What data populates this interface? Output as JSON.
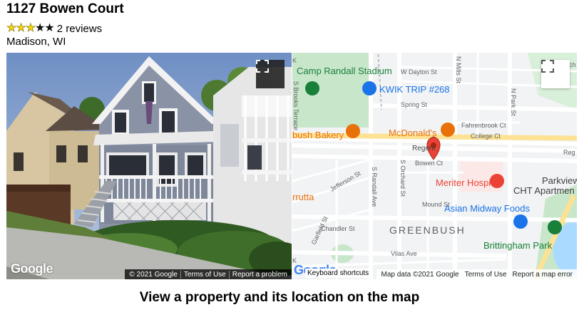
{
  "listing": {
    "title": "1127 Bowen Court",
    "rating": 3,
    "rating_max": 5,
    "reviews": "2 reviews",
    "city": "Madison, WI"
  },
  "street_view": {
    "logo": "Google",
    "attribution": [
      "© 2021 Google",
      "Terms of Use",
      "Report a problem"
    ],
    "fullscreen_icon": "fullscreen-icon"
  },
  "map": {
    "labels": {
      "camp_randall": "Camp Randall Stadium",
      "w_dayton": "W Dayton St",
      "kwik_trip": "KWIK TRIP #268",
      "spring": "Spring St",
      "bakery": "bush Bakery",
      "mcdonalds": "McDonald's",
      "fahrenbrook": "Fahrenbrook Ct",
      "college": "College Ct",
      "regent": "Regent",
      "regent_right": "Reg",
      "bowen": "Bowen Ct",
      "jefferson": "Jefferson St",
      "s_randall": "S Randall Ave",
      "s_orchard": "S Orchard St",
      "n_mills": "N Mills St",
      "n_park": "N Park St",
      "meriter": "Meriter Hospital",
      "parkview": "Parkview",
      "cht": "CHT Apartmen",
      "trutta": "rrutta",
      "mound": "Mound St",
      "asian_midway": "Asian Midway Foods",
      "greenbush": "GREENBUSH",
      "chandler": "Chandler St",
      "brittingham": "Brittingham Park",
      "vilas": "Vilas Ave",
      "garfield": "Garfield St",
      "s_brooks": "S Brooks Terrace",
      "k_top": "K",
      "k_bottom": "K",
      "ch": "ch"
    },
    "logo": "Google",
    "keyboard": "Keyboard shortcuts",
    "attribution": [
      "Map data ©2021 Google",
      "Terms of Use",
      "Report a map error"
    ],
    "fullscreen_icon": "fullscreen-icon"
  },
  "caption": "View a property and its location on the map",
  "colors": {
    "star": "#f5d60a",
    "marker": "#ea4335",
    "poi_orange": "#e8710a",
    "poi_blue": "#1a73e8",
    "poi_green": "#188038",
    "water": "#aadaff",
    "park": "#c8e6c9"
  }
}
